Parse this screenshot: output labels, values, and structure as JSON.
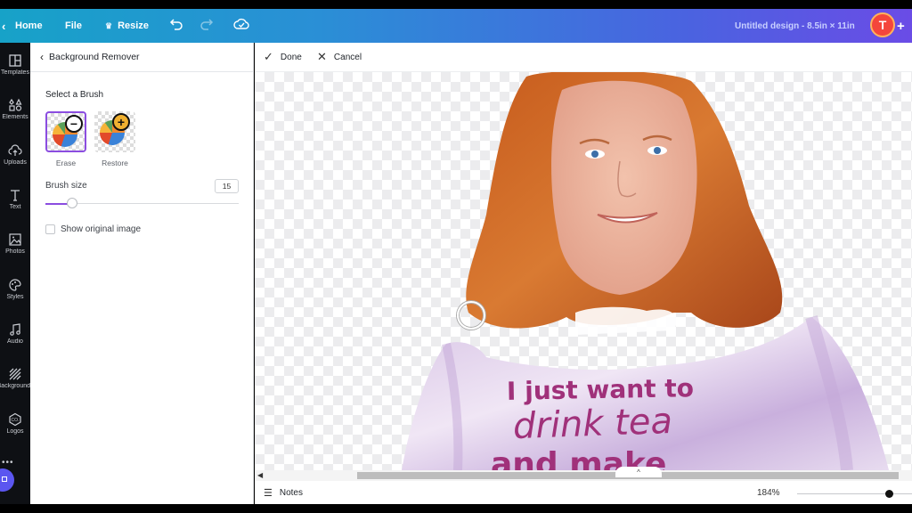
{
  "topbar": {
    "home_label": "Home",
    "file_label": "File",
    "resize_label": "Resize",
    "design_title": "Untitled design - 8.5in × 11in",
    "avatar_initial": "T",
    "add_label": "+",
    "gradient_colors": [
      "#17a2c8",
      "#6a4ce6"
    ]
  },
  "rail": {
    "items": [
      {
        "label": "Templates",
        "icon": "templates-icon"
      },
      {
        "label": "Elements",
        "icon": "elements-icon"
      },
      {
        "label": "Uploads",
        "icon": "uploads-icon"
      },
      {
        "label": "Text",
        "icon": "text-icon"
      },
      {
        "label": "Photos",
        "icon": "photos-icon"
      },
      {
        "label": "Styles",
        "icon": "styles-icon"
      },
      {
        "label": "Audio",
        "icon": "audio-icon"
      },
      {
        "label": "Background",
        "icon": "background-icon"
      },
      {
        "label": "Logos",
        "icon": "logos-icon"
      },
      {
        "label": "More",
        "icon": "more-icon"
      }
    ]
  },
  "panel": {
    "title": "Background Remover",
    "section_title": "Select a Brush",
    "brushes": [
      {
        "label": "Erase",
        "selected": true,
        "badge": "−"
      },
      {
        "label": "Restore",
        "selected": false,
        "badge": "+"
      }
    ],
    "brush_size_label": "Brush size",
    "brush_size_value": "15",
    "brush_size_fraction": 0.14,
    "show_original_label": "Show original image",
    "show_original_checked": false,
    "accent_color": "#8b4de0"
  },
  "actionbar": {
    "done_label": "Done",
    "cancel_label": "Cancel"
  },
  "canvas": {
    "shirt_text": [
      "I just want to",
      "drink tea",
      "and make"
    ]
  },
  "footer": {
    "notes_label": "Notes",
    "zoom_label": "184%",
    "zoom_fraction": 0.8,
    "page_toggle": "^"
  }
}
